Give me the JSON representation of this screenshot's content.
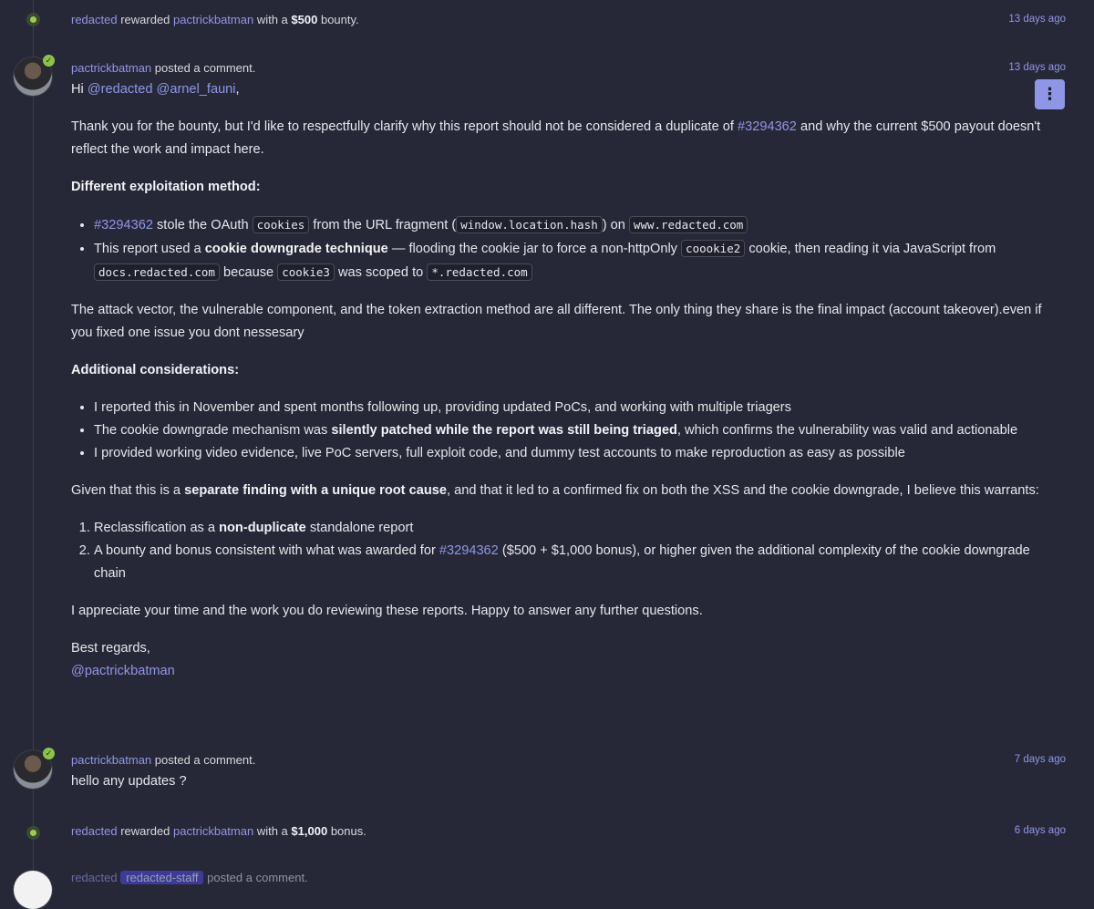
{
  "events": [
    {
      "actor": "redacted",
      "action": "rewarded",
      "target": "pactrickbatman",
      "mid": "with a",
      "amount": "$500",
      "tail": "bounty.",
      "time": "13 days ago"
    },
    {
      "actor": "redacted",
      "action": "rewarded",
      "target": "pactrickbatman",
      "mid": "with a",
      "amount": "$1,000",
      "tail": "bonus.",
      "time": "6 days ago"
    }
  ],
  "comment1": {
    "author": "pactrickbatman",
    "action": "posted a comment.",
    "time": "13 days ago",
    "greeting_pre": "Hi ",
    "mention1": "@redacted",
    "mention2": "@arnel_fauni",
    "greeting_post": ",",
    "p1_a": "Thank you for the bounty, but I'd like to respectfully clarify why this report should not be considered a duplicate of ",
    "p1_link": "#3294362",
    "p1_b": " and why the current $500 payout doesn't reflect the work and impact here.",
    "h1": "Different exploitation method:",
    "b1_link": "#3294362",
    "b1_a": " stole the OAuth ",
    "b1_code1": "cookies",
    "b1_b": " from the URL fragment (",
    "b1_code2": "window.location.hash",
    "b1_c": ") on ",
    "b1_code3": "www.redacted.com",
    "b2_a": "This report used a ",
    "b2_bold": "cookie downgrade technique",
    "b2_b": " — flooding the cookie jar to force a non-httpOnly ",
    "b2_code1": "coookie2",
    "b2_c": " cookie, then reading it via JavaScript from ",
    "b2_code2": "docs.redacted.com",
    "b2_d": " because ",
    "b2_code3": "cookie3",
    "b2_e": " was scoped to ",
    "b2_code4": "*.redacted.com",
    "p2": "The attack vector, the vulnerable component, and the token extraction method are all different. The only thing they share is the final impact (account takeover).even if you fixed one issue you dont nessesary",
    "h2": "Additional considerations:",
    "c1": "I reported this in November and spent months following up, providing updated PoCs, and working with multiple triagers",
    "c2_a": "The cookie downgrade mechanism was ",
    "c2_bold": "silently patched while the report was still being triaged",
    "c2_b": ", which confirms the vulnerability was valid and actionable",
    "c3": "I provided working video evidence, live PoC servers, full exploit code, and dummy test accounts to make reproduction as easy as possible",
    "p3_a": "Given that this is a ",
    "p3_bold": "separate finding with a unique root cause",
    "p3_b": ", and that it led to a confirmed fix on both the XSS and the cookie downgrade, I believe this warrants:",
    "o1_a": "Reclassification as a ",
    "o1_bold": "non-duplicate",
    "o1_b": " standalone report",
    "o2_a": "A bounty and bonus consistent with what was awarded for ",
    "o2_link": "#3294362",
    "o2_b": " ($500 + $1,000 bonus), or higher given the additional complexity of the cookie downgrade chain",
    "p4": "I appreciate your time and the work you do reviewing these reports. Happy to answer any further questions.",
    "signoff": "Best regards,",
    "signature": "@pactrickbatman",
    "menu_icon": "⋮"
  },
  "comment2": {
    "author": "pactrickbatman",
    "action": "posted a comment.",
    "time": "7 days ago",
    "text": "hello any updates ?"
  },
  "partial": {
    "author": "redacted",
    "tag": "redacted-staff",
    "action": "posted a comment."
  }
}
